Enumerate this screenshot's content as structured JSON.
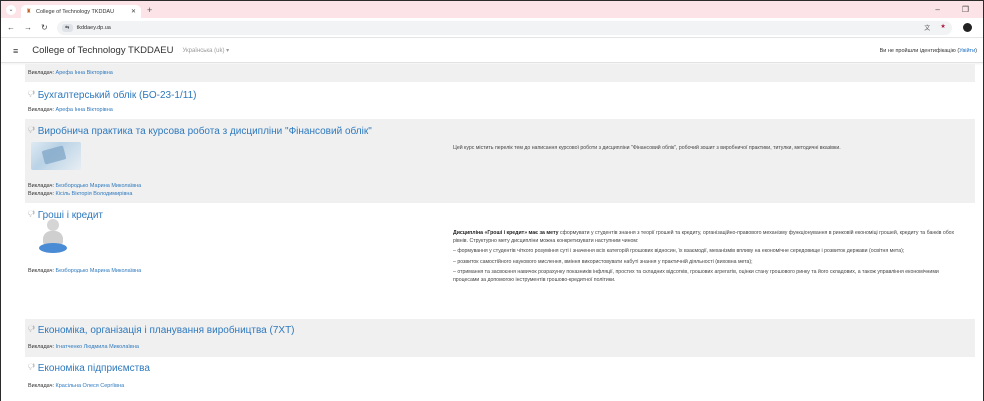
{
  "browser": {
    "tab_title": "College of Technology TKDDAU",
    "url": "tkddaey.dp.ua",
    "icons": [
      "tab-menu-icon",
      "favicon-icon",
      "close-tab-icon",
      "new-tab-icon",
      "minimize-icon",
      "maximize-icon",
      "back-icon",
      "forward-icon",
      "reload-icon",
      "site-info-icon",
      "translate-icon",
      "bookmark-star-icon",
      "profile-icon"
    ]
  },
  "navbar": {
    "site_name": "College of Technology TKDDAEU",
    "language": "Українська (uk) ▾",
    "login_text": "Ви не пройшли ідентифікацію (",
    "login_link": "Увійти",
    "login_suffix": ")"
  },
  "courses": [
    {
      "title": "",
      "teachers": [
        {
          "label": "Викладач: ",
          "name": "Арефа Інна Вікторівна"
        }
      ]
    },
    {
      "title": "Бухгалтерський облік (БО-23-1/11)",
      "teachers": [
        {
          "label": "Викладач: ",
          "name": "Арефа Інна Вікторівна"
        }
      ]
    },
    {
      "title": "Виробнича практика та курсова робота з дисципліни \"Фінансовий облік\"",
      "summary": "Цей курс містить перелік тем до написання курсової роботи з дисципліни \"Фінансовий облік\", робочий зошит з виробничої практики, титулки, методичні вказівки.",
      "teachers": [
        {
          "label": "Викладач: ",
          "name": "Безбородько Марина Миколаївна"
        },
        {
          "label": "Викладач: ",
          "name": "Кісіль Вікторія Володимирівна"
        }
      ]
    },
    {
      "title": "Гроші і кредит",
      "summary_lead": "Дисципліна «Гроші і кредит» має за мету",
      "summary_lead_rest": " сформувати у студентів знання з теорії грошей та кредиту, організаційно-правового механізму функціонування в ринковій економіці грошей, кредиту та банків обох рівнів. Структурно мету дисципліни можна конкретизувати наступним чином:",
      "summary_points": [
        "– формування у студентів чіткого розуміння суті і значення всіх категорій грошових відносин, їх взаємодії, механізмів впливу на економічне середовище і розвиток держави (освітня мета);",
        "– розвиток самостійного наукового мислення, вміння використовувати набуті знання у практичній діяльності (виховна мета);",
        "– отримання та засвоєння навичок розрахунку показників інфляції, простих та складних відсотків, грошових агрегатів, оцінки стану грошового ринку та його складових, а також управління економічними процесами за допомогою інструментів грошово-кредитної політики."
      ],
      "teachers": [
        {
          "label": "Викладач: ",
          "name": "Безбородько Марина Миколаївна"
        }
      ]
    },
    {
      "title": "Економіка, організація і планування виробництва (7ХТ)",
      "teachers": [
        {
          "label": "Викладач: ",
          "name": "Ігнатченко Людмила Миколаївна"
        }
      ]
    },
    {
      "title": "Економіка підприємства",
      "teachers": [
        {
          "label": "Викладач: ",
          "name": "Красільна Олеся Сергіївна"
        }
      ]
    }
  ]
}
